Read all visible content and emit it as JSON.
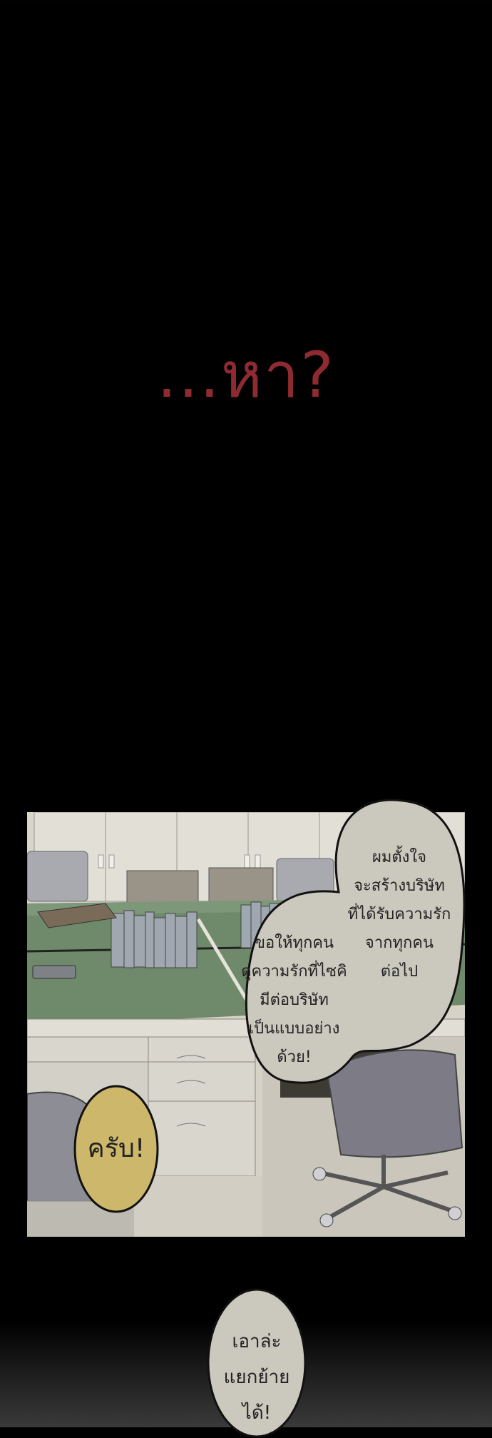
{
  "shout": "...หา?",
  "bubble_main": {
    "left_lines": [
      "ขอให้ทุกคน",
      "ดูความรักที่ไซคิ",
      "มีต่อบริษัท",
      "เป็นแบบอย่าง",
      "ด้วย!"
    ],
    "right_lines": [
      "ผมตั้งใจ",
      "จะสร้างบริษัท",
      "ที่ได้รับความรัก",
      "จากทุกคน",
      "ต่อไป"
    ]
  },
  "bubble_yellow": "ครับ!",
  "bubble_bottom": [
    "เอาล่ะ",
    "แยกย้าย",
    "ได้!"
  ],
  "colors": {
    "shout": "#8e2a30",
    "bubble_gray": "#cbc8bd",
    "bubble_yellow": "#cdb76a"
  }
}
